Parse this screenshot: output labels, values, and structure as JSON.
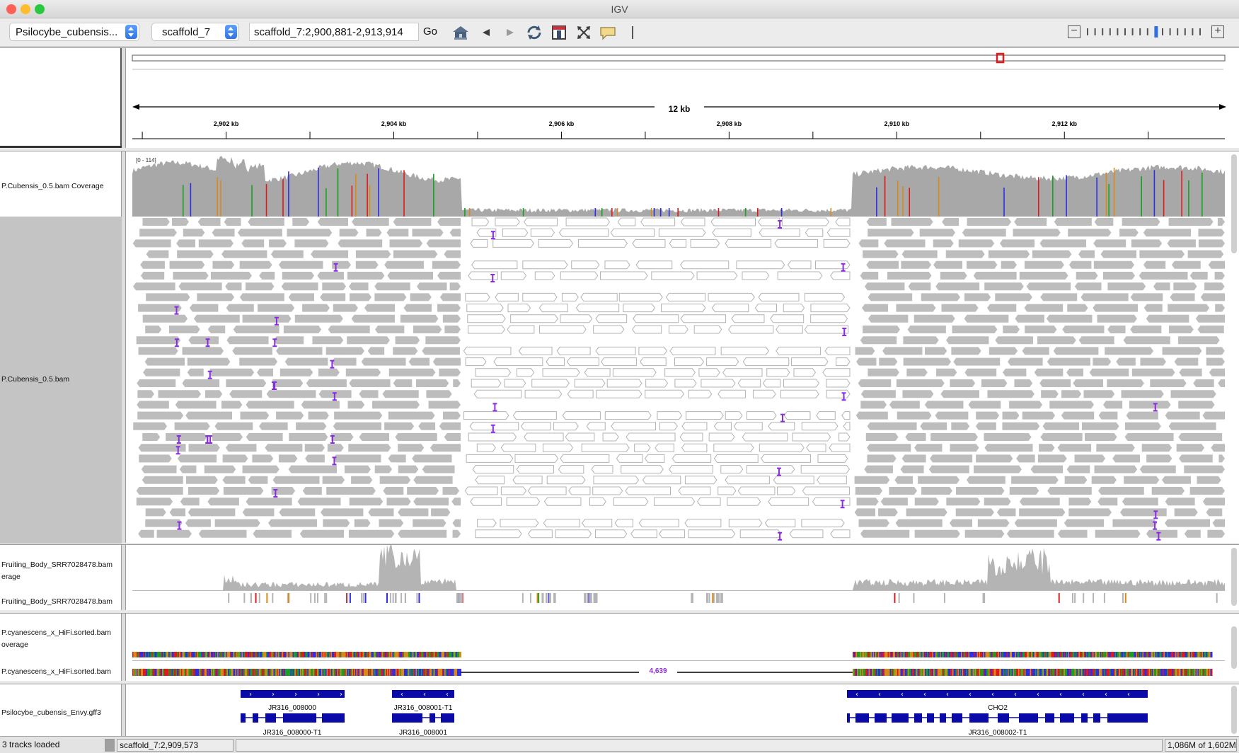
{
  "window": {
    "title": "IGV"
  },
  "toolbar": {
    "genome": "Psilocybe_cubensis...",
    "chromosome": "scaffold_7",
    "locus": "scaffold_7:2,900,881-2,913,914",
    "go_label": "Go",
    "icons": [
      "home-icon",
      "back-icon",
      "forward-icon",
      "refresh-icon",
      "region-of-interest-icon",
      "fit-window-icon",
      "popup-info-icon",
      "divider"
    ],
    "zoom_level": 9,
    "zoom_ticks": 16
  },
  "ruler": {
    "span_label": "12 kb",
    "tick_labels": [
      "2,902 kb",
      "2,904 kb",
      "2,906 kb",
      "2,908 kb",
      "2,910 kb",
      "2,912 kb"
    ],
    "tick_values_kb": [
      2902,
      2904,
      2906,
      2908,
      2910,
      2912
    ],
    "view_start_kb": 2900.881,
    "view_end_kb": 2913.914
  },
  "tracks": {
    "coverage_name": "P.Cubensis_0.5.bam Coverage",
    "coverage_range": "[0 - 114]",
    "alignment_name": "P.Cubensis_0.5.bam",
    "fruiting_coverage_name": "Fruiting_Body_SRR7028478.bam",
    "fruiting_coverage_name_2": "erage",
    "fruiting_alignment_name": "Fruiting_Body_SRR7028478.bam",
    "hifi_coverage_name": "P.cyanescens_x_HiFi.sorted.bam",
    "hifi_coverage_name_2": "overage",
    "hifi_alignment_name": "P.cyanescens_x_HiFi.sorted.bam",
    "hifi_gap_label": "4,639",
    "gff_name": "Psilocybe_cubensis_Envy.gff3"
  },
  "genes": [
    {
      "label": "JR316_008000",
      "transcript_label": "JR316_008000-T1",
      "strand": "+"
    },
    {
      "label": "JR316_008001-T1",
      "transcript_label": "JR316_008001",
      "strand": "-"
    },
    {
      "label": "CHO2",
      "transcript_label": "JR316_008002-T1",
      "strand": "-"
    }
  ],
  "status": {
    "tracks_loaded": "3 tracks loaded",
    "position": "scaffold_7:2,909,573",
    "memory": "1,086M of 1,602M"
  },
  "colors": {
    "read_gray": "#bdbdbd",
    "coverage_gray": "#a8a8a8",
    "insertion_purple": "#8a2be2",
    "gene_blue": "#0a0aa8",
    "roi_red": "#e0191b"
  }
}
